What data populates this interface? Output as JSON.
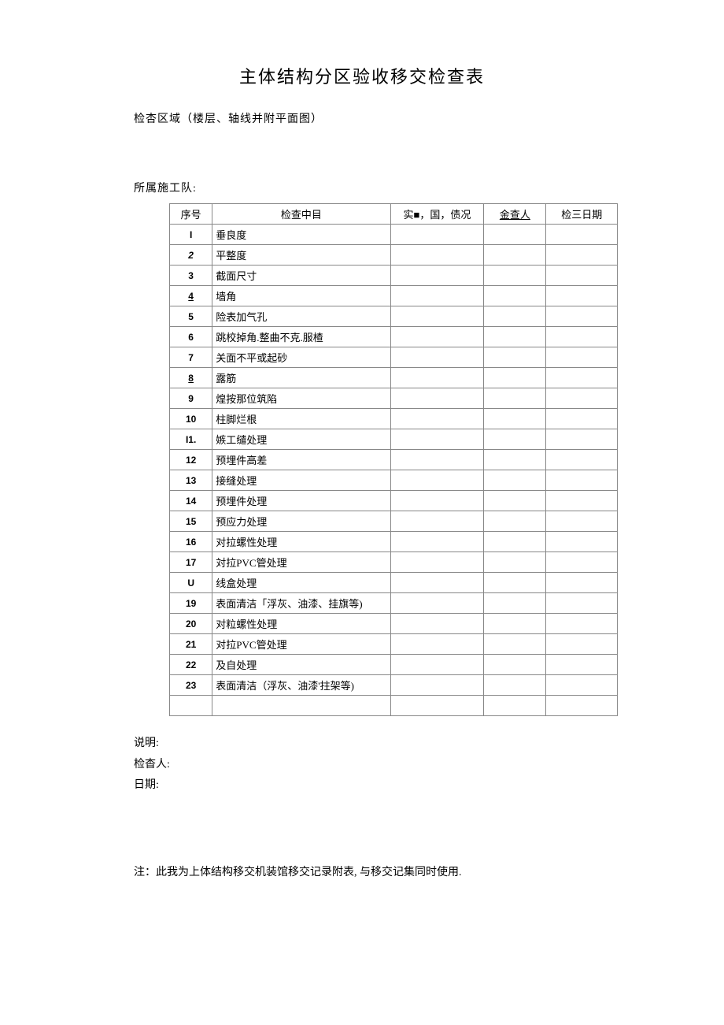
{
  "title": "主体结构分区验收移交检查表",
  "check_area_label": "检杏区域（楼层、轴线并附平面图）",
  "team_label": "所属施工队:",
  "headers": {
    "seq": "序号",
    "item": "检查中目",
    "status": "实■，国，债况",
    "person": "金查人",
    "date": "检三日期"
  },
  "rows": [
    {
      "seq": "I",
      "item": "垂良度"
    },
    {
      "seq": "2",
      "item": "平整度"
    },
    {
      "seq": "3",
      "item": "截面尺寸"
    },
    {
      "seq": "4",
      "item": "墙角"
    },
    {
      "seq": "5",
      "item": "险表加气孔"
    },
    {
      "seq": "6",
      "item": "跳校掉角.整曲不克.服楂"
    },
    {
      "seq": "7",
      "item": "关面不平或起砂"
    },
    {
      "seq": "8",
      "item": "露筋"
    },
    {
      "seq": "9",
      "item": "煌按那位筑陷"
    },
    {
      "seq": "10",
      "item": "柱脚烂根"
    },
    {
      "seq": "I1.",
      "item": "嫉工缱处理"
    },
    {
      "seq": "12",
      "item": "预埋件高差"
    },
    {
      "seq": "13",
      "item": "接缝处理"
    },
    {
      "seq": "14",
      "item": "预埋件处理"
    },
    {
      "seq": "15",
      "item": "预应力处理"
    },
    {
      "seq": "16",
      "item": "对拉螺性处理"
    },
    {
      "seq": "17",
      "item": "対拉PVC管处理"
    },
    {
      "seq": "U",
      "item": "线盒处理"
    },
    {
      "seq": "19",
      "item": "表面清洁「浮灰、油漆、挂旗等)"
    },
    {
      "seq": "20",
      "item": "对粒螺性处理"
    },
    {
      "seq": "21",
      "item": "对拉PVC管处理"
    },
    {
      "seq": "22",
      "item": "及自处理"
    },
    {
      "seq": "23",
      "item": "表面清洁（浮灰、油漆'拄架等)"
    },
    {
      "seq": "",
      "item": ""
    }
  ],
  "footer": {
    "explanation": "说明:",
    "inspector": "检杳人:",
    "date": "日期:"
  },
  "note": "注：此我为上体结构移交机装馆移交记录附表, 与移交记集同时使用."
}
